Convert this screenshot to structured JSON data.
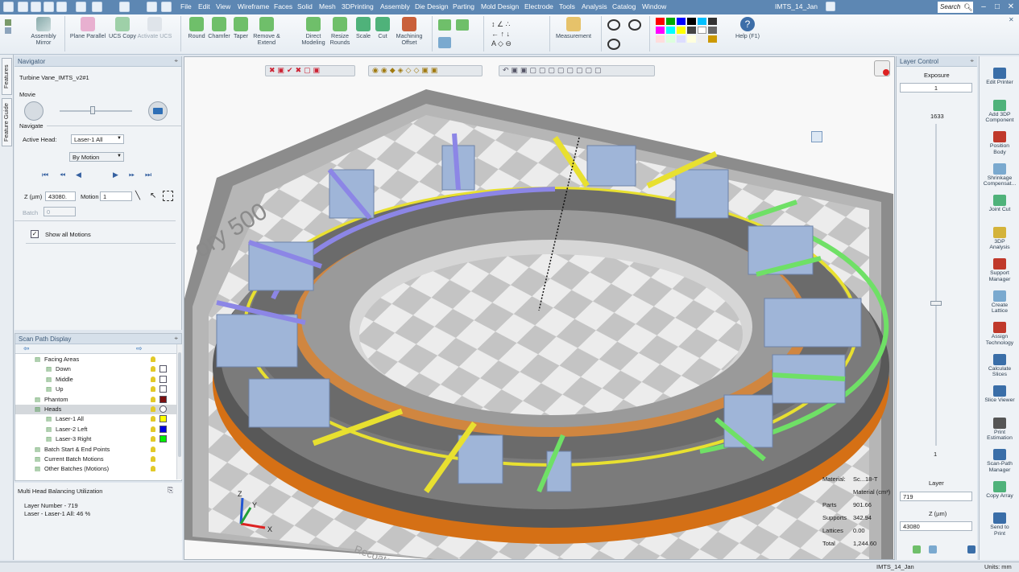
{
  "menu": {
    "items": [
      "File",
      "Edit",
      "View",
      "Wireframe",
      "Faces",
      "Solid",
      "Mesh",
      "3DPrinting",
      "Assembly",
      "Die Design",
      "Parting",
      "Mold Design",
      "Electrode",
      "Tools",
      "Analysis",
      "Catalog",
      "Window"
    ],
    "document": "IMTS_14_Jan",
    "search_placeholder": "Search"
  },
  "ribbon": {
    "assembly_mirror": "Assembly\nMirror",
    "plane_parallel": "Plane Parallel",
    "ucs_copy": "UCS Copy",
    "activate_ucs": "Activate UCS",
    "round": "Round",
    "chamfer": "Chamfer",
    "taper": "Taper",
    "remove_extend": "Remove &\nExtend",
    "direct_modeling": "Direct\nModeling",
    "resize_rounds": "Resize\nRounds",
    "scale": "Scale",
    "cut": "Cut",
    "machining_offset": "Machining\nOffset",
    "measurement": "Measurement",
    "help": "Help (F1)"
  },
  "left_tabs": {
    "features": "Features",
    "feature_guide": "Feature Guide"
  },
  "navigator": {
    "title": "Navigator",
    "part_name": "Turbine Vane_IMTS_v2#1",
    "move_label": "Movie",
    "navigate_label": "Navigate",
    "active_head_label": "Active Head:",
    "active_head_value": "Laser-1 All",
    "motion_mode": "By Motion",
    "z_label": "Z (µm)",
    "z_value": "43080.",
    "motion_label": "Motion",
    "motion_value": "1",
    "batch_label": "Batch",
    "batch_value": "0",
    "show_all_motions": "Show all Motions"
  },
  "scan_path": {
    "title": "Scan Path Display",
    "rows": [
      {
        "label": "Facing Areas",
        "indent": 1,
        "color": ""
      },
      {
        "label": "Down",
        "indent": 2,
        "color": "#ffffff"
      },
      {
        "label": "Middle",
        "indent": 2,
        "color": "#ffffff"
      },
      {
        "label": "Up",
        "indent": 2,
        "color": "#ffffff"
      },
      {
        "label": "Phantom",
        "indent": 1,
        "color": "#7a1010"
      },
      {
        "label": "Heads",
        "indent": 1,
        "color": "selected"
      },
      {
        "label": "Laser-1 All",
        "indent": 2,
        "color": "#ffff00"
      },
      {
        "label": "Laser-2 Left",
        "indent": 2,
        "color": "#0000dd"
      },
      {
        "label": "Laser-3 Right",
        "indent": 2,
        "color": "#00ee00"
      },
      {
        "label": "Batch Start & End Points",
        "indent": 1,
        "color": ""
      },
      {
        "label": "Current Batch Motions",
        "indent": 1,
        "color": ""
      },
      {
        "label": "Other Batches (Motions)",
        "indent": 1,
        "color": ""
      }
    ]
  },
  "utilization": {
    "title": "Multi Head Balancing Utilization",
    "layer_number": "Layer Number - 719",
    "laser_util": "Laser - Laser-1 All:   46 %"
  },
  "viewport": {
    "platform_text": "ory 500",
    "recoater_text": "Recoater",
    "axes": {
      "x": "X",
      "y": "Y",
      "z": "Z"
    },
    "material_table": {
      "rows": [
        {
          "label": "Material:",
          "value": "Sc...18-T"
        },
        {
          "label": "",
          "value": "Material (cm³)"
        },
        {
          "label": "Parts",
          "value": "901.66"
        },
        {
          "label": "Supports",
          "value": "342.94"
        },
        {
          "label": "Lattices",
          "value": "0.00"
        },
        {
          "label": "Total",
          "value": "1,244.60"
        }
      ]
    }
  },
  "layer_control": {
    "title": "Layer Control",
    "exposure_label": "Exposure",
    "exposure_value": "1",
    "top_value": "1633",
    "bottom_value": "1",
    "layer_label": "Layer",
    "layer_value": "719",
    "z_label": "Z (µm)",
    "z_value": "43080"
  },
  "tools": [
    "Edit Printer",
    "Add 3DP\nComponent",
    "Position\nBody",
    "Shrinkage\nCompensat...",
    "Joint Cut",
    "3DP\nAnalysis",
    "Support\nManager",
    "Create\nLattice",
    "Assign\nTechnology",
    "Calculate\nSlices",
    "Slice Viewer",
    "Print\nEstimation",
    "Scan-Path\nManager",
    "Copy Array",
    "Send to\nPrint"
  ],
  "status": {
    "document": "IMTS_14_Jan",
    "units": "Units: mm"
  }
}
